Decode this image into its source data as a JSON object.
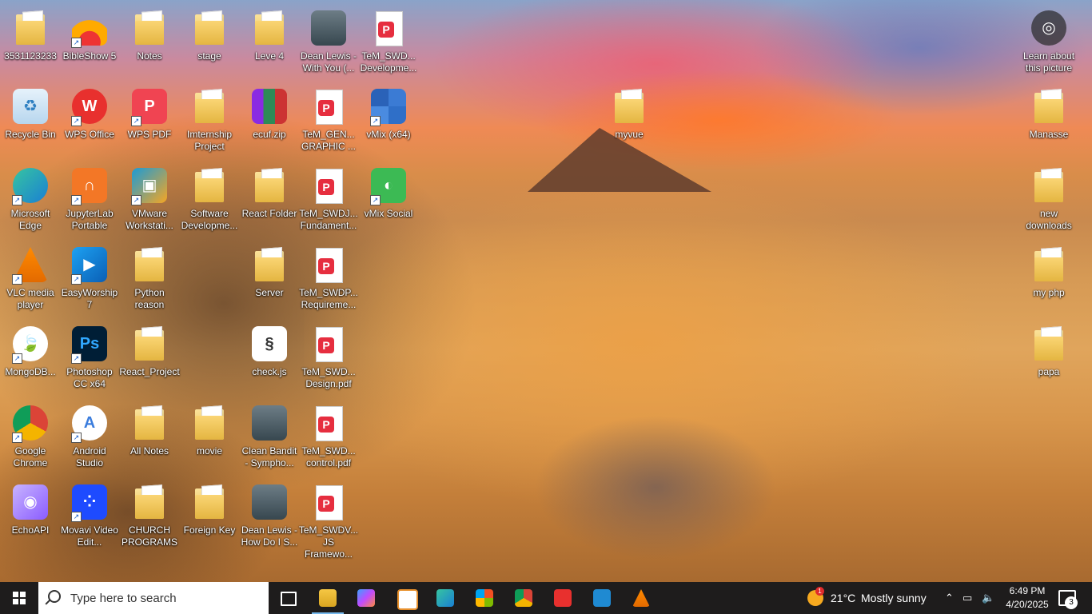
{
  "desktop": {
    "left_columns": [
      [
        {
          "label": "3531123233",
          "icon": "folder-icon"
        },
        {
          "label": "Recycle Bin",
          "icon": "recycle-bin-icon"
        },
        {
          "label": "Microsoft Edge",
          "icon": "edge-icon"
        },
        {
          "label": "VLC media player",
          "icon": "vlc-icon"
        },
        {
          "label": "MongoDB...",
          "icon": "mongodb-icon"
        },
        {
          "label": "Google Chrome",
          "icon": "chrome-icon"
        },
        {
          "label": "EchoAPI",
          "icon": "echoapi-icon"
        }
      ],
      [
        {
          "label": "BibleShow 5",
          "icon": "bibleshow-icon"
        },
        {
          "label": "WPS Office",
          "icon": "wps-office-icon"
        },
        {
          "label": "JupyterLab Portable",
          "icon": "jupyterlab-icon"
        },
        {
          "label": "EasyWorship 7",
          "icon": "easyworship-icon"
        },
        {
          "label": "Photoshop CC x64",
          "icon": "photoshop-icon"
        },
        {
          "label": "Android Studio",
          "icon": "android-studio-icon"
        },
        {
          "label": "Movavi Video Edit...",
          "icon": "movavi-icon"
        }
      ],
      [
        {
          "label": "Notes",
          "icon": "folder-icon"
        },
        {
          "label": "WPS PDF",
          "icon": "wps-pdf-icon"
        },
        {
          "label": "VMware Workstati...",
          "icon": "vmware-icon"
        },
        {
          "label": "Python reason",
          "icon": "folder-icon"
        },
        {
          "label": "React_Project",
          "icon": "folder-icon"
        },
        {
          "label": "All Notes",
          "icon": "folder-icon"
        },
        {
          "label": "CHURCH PROGRAMS",
          "icon": "folder-icon"
        }
      ],
      [
        {
          "label": "stage",
          "icon": "folder-icon"
        },
        {
          "label": "Imternship Project",
          "icon": "folder-icon"
        },
        {
          "label": "Software Developme...",
          "icon": "folder-icon"
        },
        {
          "label": "",
          "icon": "empty"
        },
        {
          "label": "",
          "icon": "empty"
        },
        {
          "label": "movie",
          "icon": "folder-icon"
        },
        {
          "label": "Foreign Key",
          "icon": "folder-icon"
        }
      ],
      [
        {
          "label": "Leve 4",
          "icon": "folder-icon"
        },
        {
          "label": "ecuf.zip",
          "icon": "winrar-zip-icon"
        },
        {
          "label": "React Folder",
          "icon": "folder-icon"
        },
        {
          "label": "Server",
          "icon": "folder-icon"
        },
        {
          "label": "check.js",
          "icon": "js-file-icon"
        },
        {
          "label": "Clean Bandit - Sympho...",
          "icon": "video-file-icon"
        },
        {
          "label": "Dean Lewis - How Do I S...",
          "icon": "video-file-icon"
        }
      ],
      [
        {
          "label": "Dean Lewis - With You (...",
          "icon": "video-file-icon"
        },
        {
          "label": "TeM_GEN... GRAPHIC ...",
          "icon": "pdf-file-icon"
        },
        {
          "label": "TeM_SWDJ... Fundament...",
          "icon": "pdf-file-icon"
        },
        {
          "label": "TeM_SWDP... Requireme...",
          "icon": "pdf-file-icon"
        },
        {
          "label": "TeM_SWD... Design.pdf",
          "icon": "pdf-file-icon"
        },
        {
          "label": "TeM_SWD... control.pdf",
          "icon": "pdf-file-icon"
        },
        {
          "label": "TeM_SWDV... JS Framewo...",
          "icon": "pdf-file-icon"
        }
      ],
      [
        {
          "label": "TeM_SWD... Developme...",
          "icon": "pdf-file-icon"
        },
        {
          "label": "vMix (x64)",
          "icon": "vmix-icon"
        },
        {
          "label": "vMix Social",
          "icon": "vmix-social-icon"
        }
      ]
    ],
    "middle_icon": {
      "label": "myvue",
      "icon": "folder-icon"
    },
    "right_column": [
      {
        "label": "Learn about this picture",
        "icon": "learn-about-picture-icon"
      },
      {
        "label": "Manasse",
        "icon": "folder-icon"
      },
      {
        "label": "new downloads",
        "icon": "folder-icon"
      },
      {
        "label": "my php",
        "icon": "folder-icon"
      },
      {
        "label": "papa",
        "icon": "folder-icon"
      }
    ]
  },
  "taskbar": {
    "search_placeholder": "Type here to search",
    "pinned": [
      {
        "name": "task-view-button",
        "icon": "task-view-icon"
      },
      {
        "name": "file-explorer-button",
        "icon": "file-explorer-icon",
        "active": true
      },
      {
        "name": "copilot-button",
        "icon": "copilot-icon"
      },
      {
        "name": "paint-button",
        "icon": "paint-icon"
      },
      {
        "name": "edge-button",
        "icon": "edge-icon"
      },
      {
        "name": "store-button",
        "icon": "store-icon"
      },
      {
        "name": "chrome-button",
        "icon": "chrome-icon"
      },
      {
        "name": "wps-button",
        "icon": "wps-icon"
      },
      {
        "name": "vscode-button",
        "icon": "vscode-icon"
      },
      {
        "name": "vlc-button",
        "icon": "vlc-icon"
      }
    ],
    "weather": {
      "temp": "21°C",
      "condition": "Mostly sunny",
      "badge": "1"
    },
    "clock": {
      "time": "6:49 PM",
      "date": "4/20/2025"
    },
    "notification_count": "3"
  },
  "colors": {
    "taskbar_bg": "#1e1c1c",
    "folder_yellow": "#f2c94c",
    "pdf_red": "#e62e3f",
    "accent_blue": "#76b9ed"
  }
}
